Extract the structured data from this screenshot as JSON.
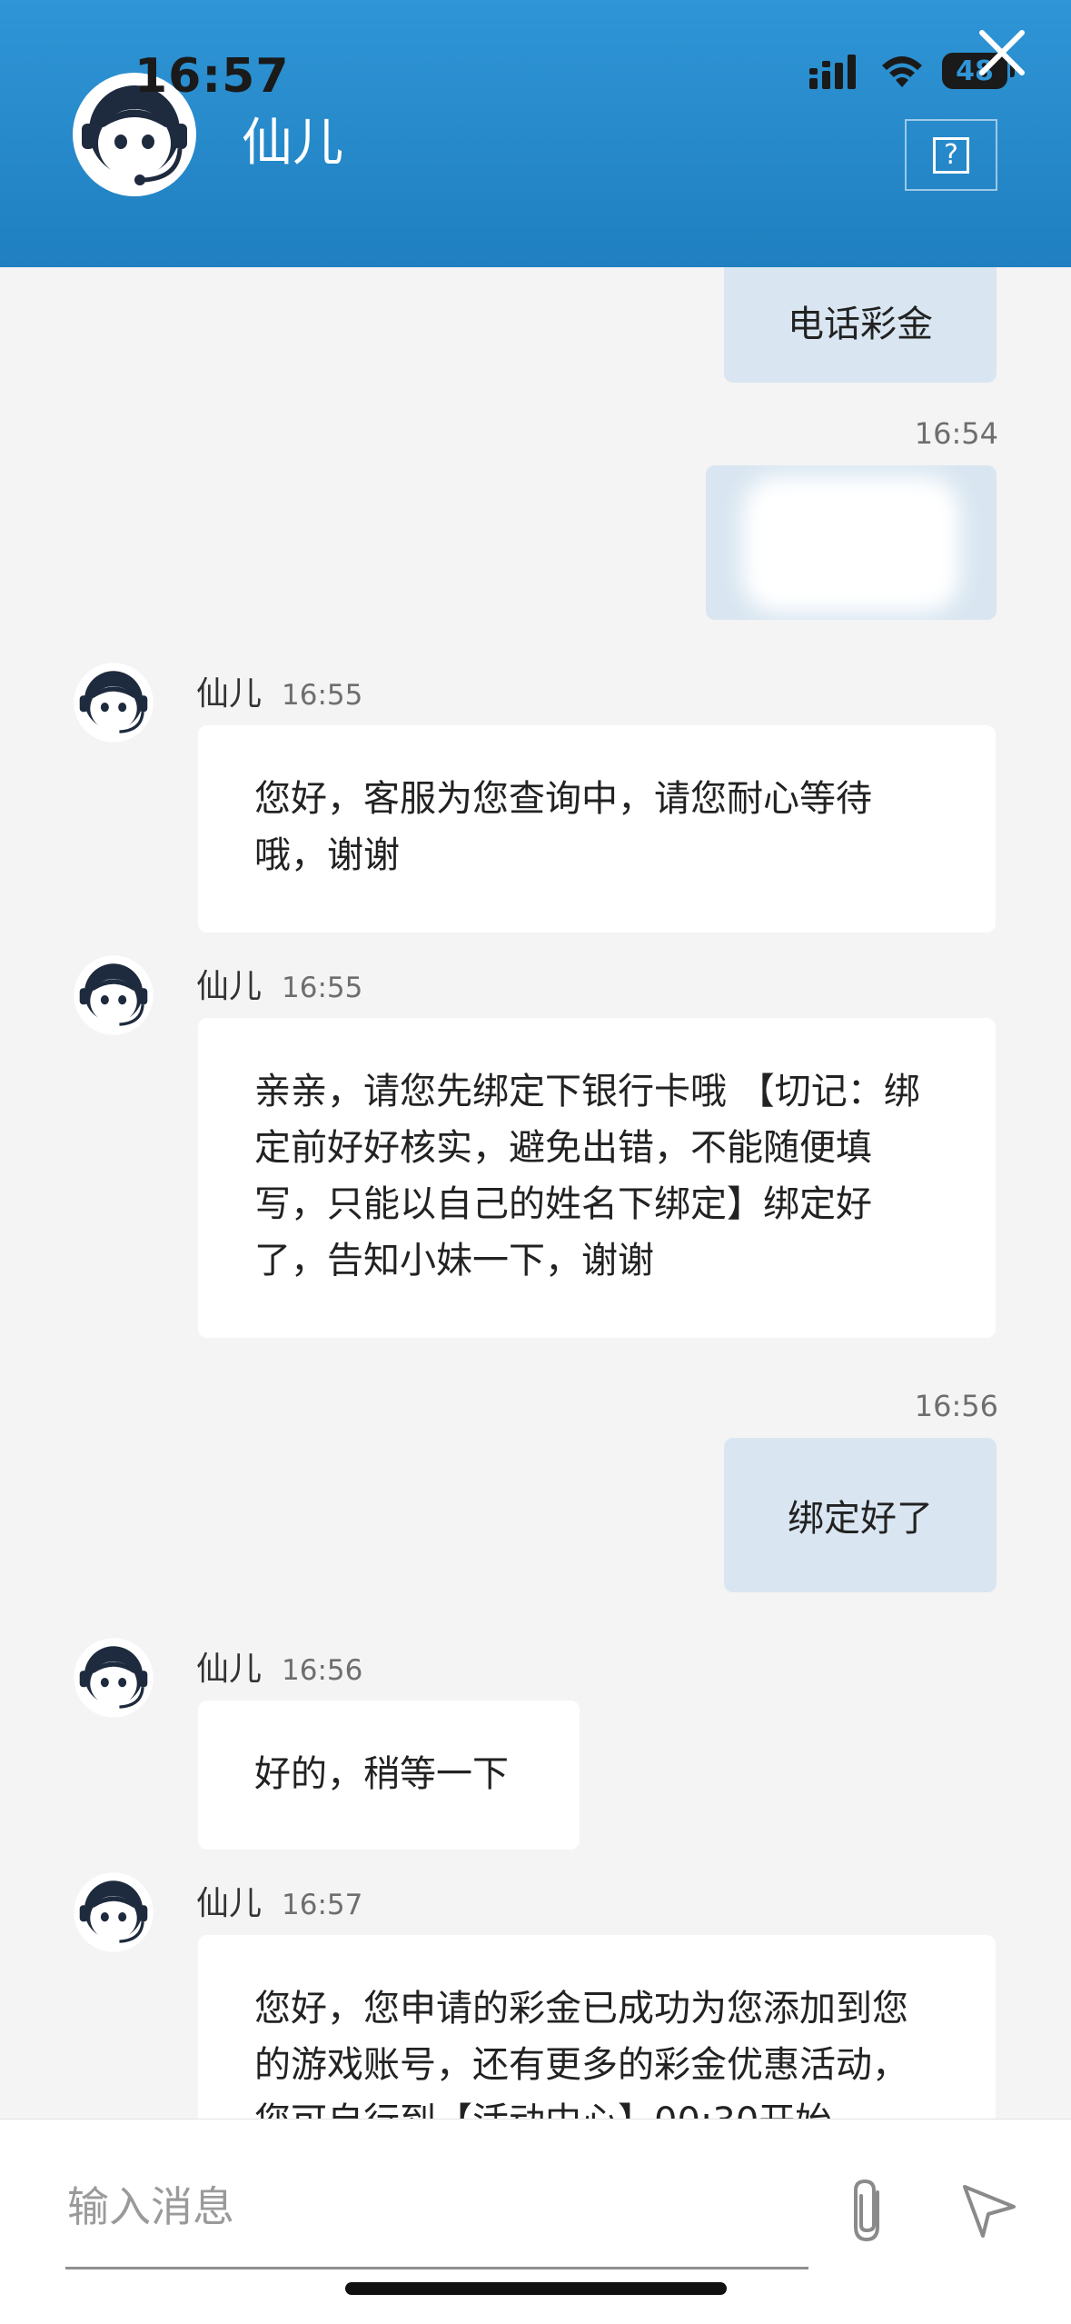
{
  "status_bar": {
    "time": "16:57",
    "battery": "48"
  },
  "header": {
    "agent_name": "仙儿",
    "help_label": "?"
  },
  "messages": [
    {
      "side": "out",
      "text": "电话彩金"
    },
    {
      "side": "out",
      "time": "16:54",
      "text": ""
    },
    {
      "side": "in",
      "sender": "仙儿",
      "time": "16:55",
      "text": "您好，客服为您查询中，请您耐心等待哦，谢谢"
    },
    {
      "side": "in",
      "sender": "仙儿",
      "time": "16:55",
      "text": "亲亲，请您先绑定下银行卡哦 【切记：绑定前好好核实，避免出错，不能随便填写，只能以自己的姓名下绑定】绑定好了，告知小妹一下，谢谢"
    },
    {
      "side": "out",
      "time": "16:56",
      "text": "绑定好了"
    },
    {
      "side": "in",
      "sender": "仙儿",
      "time": "16:56",
      "text": "好的，稍等一下"
    },
    {
      "side": "in",
      "sender": "仙儿",
      "time": "16:57",
      "text": "您好，您申请的彩金已成功为您添加到您的游戏账号，还有更多的彩金优惠活动，您可自行到【活动中心】00:30开始"
    }
  ],
  "input": {
    "placeholder": "输入消息"
  },
  "colors": {
    "header": "#2a8fd0",
    "outgoing_bubble": "#d9e6f1",
    "incoming_bubble": "#ffffff",
    "background": "#f4f4f4"
  },
  "icons": [
    "signal-icon",
    "wifi-icon",
    "battery-icon",
    "close-icon",
    "help-icon",
    "avatar-icon",
    "scroll-down-icon",
    "attachment-icon",
    "send-icon"
  ]
}
